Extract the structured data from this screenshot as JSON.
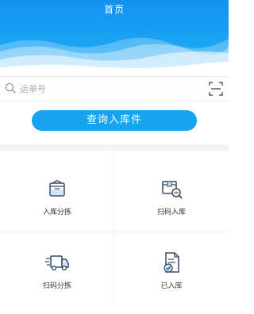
{
  "header": {
    "title": "首页"
  },
  "search": {
    "placeholder": "运单号",
    "left_icon": "search-icon",
    "right_icon": "scan-icon"
  },
  "query_button": {
    "label": "查询入库件"
  },
  "grid": {
    "items": [
      {
        "label": "入库分拣",
        "icon": "basket-icon"
      },
      {
        "label": "扫码入库",
        "icon": "scan-box-icon"
      },
      {
        "label": "扫码分拣",
        "icon": "truck-icon"
      },
      {
        "label": "已入库",
        "icon": "document-check-icon"
      }
    ]
  },
  "colors": {
    "primary": "#16a3ef",
    "header_top": "#1590f0",
    "icon_stroke": "#3a4a66"
  }
}
